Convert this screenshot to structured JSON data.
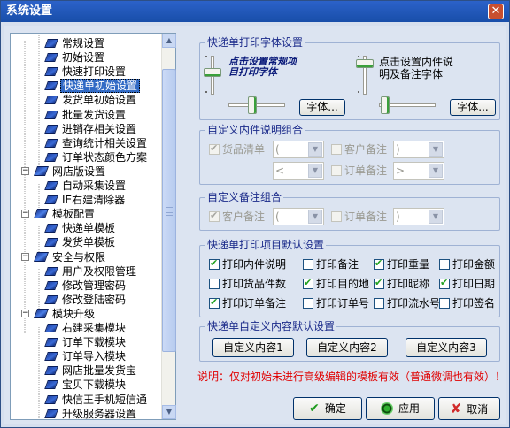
{
  "window": {
    "title": "系统设置"
  },
  "tree": {
    "items": [
      {
        "label": "常规设置",
        "selected": false
      },
      {
        "label": "初始设置",
        "selected": false
      },
      {
        "label": "快速打印设置",
        "selected": false
      },
      {
        "label": "快递单初始设置",
        "selected": true
      },
      {
        "label": "发货单初始设置",
        "selected": false
      },
      {
        "label": "批量发货设置",
        "selected": false
      },
      {
        "label": "进销存相关设置",
        "selected": false
      },
      {
        "label": "查询统计相关设置",
        "selected": false
      },
      {
        "label": "订单状态颜色方案",
        "selected": false
      },
      {
        "label": "网店版设置",
        "selected": false
      },
      {
        "label": "自动采集设置",
        "selected": false
      },
      {
        "label": "IE右建清除器",
        "selected": false
      },
      {
        "label": "模板配置",
        "selected": false
      },
      {
        "label": "快递单模板",
        "selected": false
      },
      {
        "label": "发货单模板",
        "selected": false
      },
      {
        "label": "安全与权限",
        "selected": false
      },
      {
        "label": "用户及权限管理",
        "selected": false
      },
      {
        "label": "修改管理密码",
        "selected": false
      },
      {
        "label": "修改登陆密码",
        "selected": false
      },
      {
        "label": "模块升级",
        "selected": false
      },
      {
        "label": "右建采集模块",
        "selected": false
      },
      {
        "label": "订单下载模块",
        "selected": false
      },
      {
        "label": "订单导入模块",
        "selected": false
      },
      {
        "label": "网店批量发货宝",
        "selected": false
      },
      {
        "label": "宝贝下载模块",
        "selected": false
      },
      {
        "label": "快信王手机短信通",
        "selected": false
      },
      {
        "label": "升级服务器设置",
        "selected": false
      }
    ]
  },
  "font_group": {
    "title": "快递单打印字体设置",
    "preview_left": "点击设置常规项目打印字体",
    "preview_right": "点击设置内件说明及备注字体",
    "font_button_left": "字体...",
    "font_button_right": "字体..."
  },
  "content_group": {
    "title": "自定义内件说明组合",
    "goods_list_label": "货品清单",
    "goods_list_checked": true,
    "customer_note_label": "客户备注",
    "customer_note_checked": false,
    "order_note_label": "订单备注",
    "order_note_checked": false,
    "combo_values": [
      "(",
      ")",
      "<",
      ">"
    ]
  },
  "remark_group": {
    "title": "自定义备注组合",
    "customer_note_label": "客户备注",
    "customer_note_checked": true,
    "order_note_label": "订单备注",
    "order_note_checked": false,
    "combo_values": [
      "(",
      ")"
    ]
  },
  "print_items_group": {
    "title": "快递单打印项目默认设置",
    "items": [
      {
        "label": "打印内件说明",
        "checked": true
      },
      {
        "label": "打印备注",
        "checked": false
      },
      {
        "label": "打印重量",
        "checked": true
      },
      {
        "label": "打印金额",
        "checked": false
      },
      {
        "label": "打印货品件数",
        "checked": false
      },
      {
        "label": "打印目的地",
        "checked": true
      },
      {
        "label": "打印昵称",
        "checked": true
      },
      {
        "label": "打印日期",
        "checked": true
      },
      {
        "label": "打印订单备注",
        "checked": true
      },
      {
        "label": "打印订单号",
        "checked": false
      },
      {
        "label": "打印流水号",
        "checked": false
      },
      {
        "label": "打印签名",
        "checked": false
      }
    ]
  },
  "custom_content_group": {
    "title": "快递单自定义内容默认设置",
    "buttons": [
      "自定义内容1",
      "自定义内容2",
      "自定义内容3"
    ]
  },
  "note": "说明：仅对初始未进行高级编辑的模板有效（普通微调也有效）！",
  "footer": {
    "ok_label": "确定",
    "apply_label": "应用",
    "cancel_label": "取消"
  }
}
